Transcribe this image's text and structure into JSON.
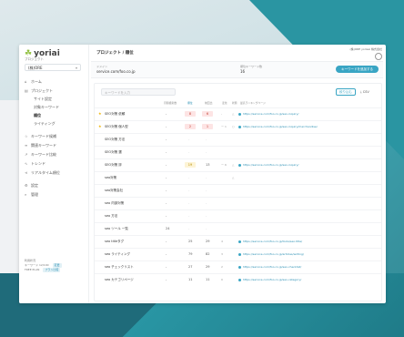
{
  "brand": {
    "name": "yoriai",
    "sub": "プロジェクト"
  },
  "sidebar": {
    "project_label": "プロジェクト",
    "project_value": "(株)ORE",
    "items": [
      {
        "label": "ホーム",
        "icon": "home-icon"
      },
      {
        "label": "プロジェクト",
        "icon": "folder-icon"
      },
      {
        "label": "サイト設定",
        "sub": true
      },
      {
        "label": "対象キーワード",
        "sub": true
      },
      {
        "label": "順位",
        "sub": true,
        "active": true
      },
      {
        "label": "ライティング",
        "sub": true
      },
      {
        "label": "キーワード候補",
        "icon": "star-icon"
      },
      {
        "label": "関連キーワード",
        "icon": "list-icon"
      },
      {
        "label": "キーワード比較",
        "icon": "trend-icon"
      },
      {
        "label": "トレンド",
        "icon": "chart-icon"
      },
      {
        "label": "リアルタイム順位",
        "icon": "share-icon"
      },
      {
        "label": "設定",
        "icon": "gear-icon"
      },
      {
        "label": "管理",
        "icon": "search-icon"
      }
    ],
    "footer": {
      "line1": "利用状況",
      "line2": "キーワード 12/100",
      "line3": "FREE PLAN",
      "btn1": "変更",
      "btn2": "プラン比較"
    }
  },
  "header": {
    "breadcrumb": "プロジェクト / 順位",
    "user": "(株)ORE yorisai 株式会社"
  },
  "info": {
    "domain_label": "ドメイン",
    "domain": "service.com/foo.co.jp",
    "kw_label": "順位キーワード数",
    "kw_count": "16",
    "add_button": "キーワードを追加する"
  },
  "toolbar": {
    "search_placeholder": "キーワードを入力",
    "filter_button": "絞り込む",
    "csv_button": "CSV"
  },
  "table": {
    "headers": [
      "月間検索数",
      "順位",
      "前回比",
      "変化",
      "状態",
      "最高ランキングページ"
    ],
    "rows": [
      {
        "star": true,
        "kw": "SEO対策 依頼",
        "vol": "-",
        "rank": "8",
        "prev": "6",
        "chg": "-",
        "state": "△",
        "url": "https://service.com/foo.co.jp/seo-inquiry/"
      },
      {
        "star": true,
        "kw": "SEO対策 個人型",
        "vol": "-",
        "rank": "2",
        "prev": "1",
        "chg": "ー 1",
        "state": "○",
        "url": "https://service.com/foo.co.jp/seo-inquiry/merchandise/"
      },
      {
        "star": false,
        "kw": "SEO対策 方法",
        "vol": "-",
        "rank": "-",
        "prev": "-",
        "chg": "",
        "state": "",
        "url": ""
      },
      {
        "star": false,
        "kw": "SEO対策 選",
        "vol": "-",
        "rank": "-",
        "prev": "-",
        "chg": "",
        "state": "",
        "url": ""
      },
      {
        "star": false,
        "kw": "SEO対策 評",
        "vol": "-",
        "rank": "19",
        "prev": "13",
        "chg": "ー 6",
        "state": "△",
        "url": "https://service.com/foo.co.jp/seo-inquiry/"
      },
      {
        "star": false,
        "kw": "seo対策",
        "vol": "-",
        "rank": "-",
        "prev": "-",
        "chg": "",
        "state": "△",
        "url": ""
      },
      {
        "star": false,
        "kw": "seo対策会社",
        "vol": "-",
        "rank": "-",
        "prev": "-",
        "chg": "",
        "state": "",
        "url": ""
      },
      {
        "star": false,
        "kw": "seo 内部対策",
        "vol": "-",
        "rank": "-",
        "prev": "-",
        "chg": "",
        "state": "",
        "url": ""
      },
      {
        "star": false,
        "kw": "seo 方法",
        "vol": "-",
        "rank": "-",
        "prev": "-",
        "chg": "",
        "state": "",
        "url": ""
      },
      {
        "star": false,
        "kw": "seo ツール 一覧",
        "vol": "24",
        "rank": "-",
        "prev": "-",
        "chg": "",
        "state": "",
        "url": ""
      },
      {
        "star": false,
        "kw": "seo titleタグ",
        "vol": "-",
        "rank": "25",
        "prev": "29",
        "chg": "4",
        "state": "",
        "url": "https://service.com/foo.co.jp/tools/seo-title/"
      },
      {
        "star": false,
        "kw": "seo ライティング",
        "vol": "-",
        "rank": "79",
        "prev": "82",
        "chg": "3",
        "state": "",
        "url": "https://service.com/foo.co.jp/articles/writing/"
      },
      {
        "star": false,
        "kw": "seo チェックリスト",
        "vol": "-",
        "rank": "27",
        "prev": "29",
        "chg": "2",
        "state": "",
        "url": "https://service.com/foo.co.jp/seo-checklist/"
      },
      {
        "star": false,
        "kw": "seo カテゴリページ",
        "vol": "-",
        "rank": "11",
        "prev": "11",
        "chg": "0",
        "state": "",
        "url": "https://service.com/foo.co.jp/seo-category/"
      }
    ]
  },
  "colors": {
    "accent": "#39a5c4",
    "teal_bg": "#1f6b7a",
    "red_badge": "#fde4e4",
    "yellow_badge": "#fdf4d6"
  }
}
